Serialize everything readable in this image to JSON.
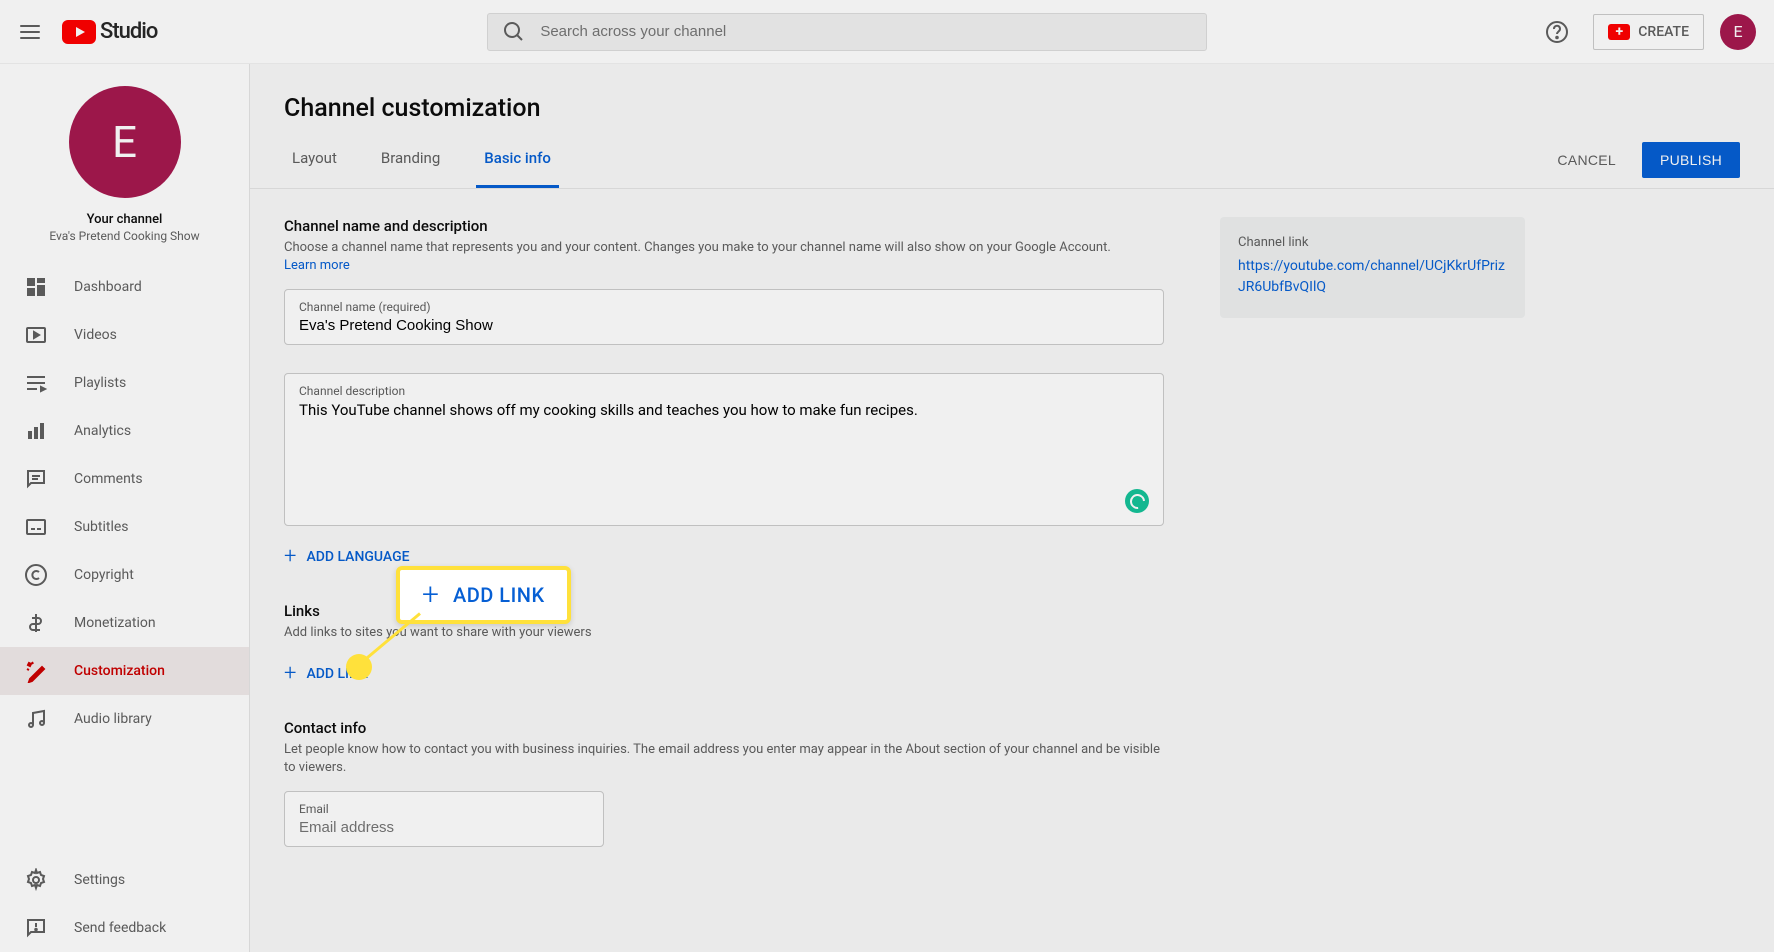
{
  "header": {
    "logo_text": "Studio",
    "search_placeholder": "Search across your channel",
    "create_label": "CREATE",
    "avatar_initial": "E"
  },
  "sidebar": {
    "channel_avatar_initial": "E",
    "your_channel_label": "Your channel",
    "channel_name": "Eva's Pretend Cooking Show",
    "items": [
      {
        "label": "Dashboard"
      },
      {
        "label": "Videos"
      },
      {
        "label": "Playlists"
      },
      {
        "label": "Analytics"
      },
      {
        "label": "Comments"
      },
      {
        "label": "Subtitles"
      },
      {
        "label": "Copyright"
      },
      {
        "label": "Monetization"
      },
      {
        "label": "Customization"
      },
      {
        "label": "Audio library"
      }
    ],
    "footer": [
      {
        "label": "Settings"
      },
      {
        "label": "Send feedback"
      }
    ]
  },
  "page": {
    "title": "Channel customization",
    "tabs": [
      {
        "label": "Layout"
      },
      {
        "label": "Branding"
      },
      {
        "label": "Basic info"
      }
    ],
    "cancel_label": "CANCEL",
    "publish_label": "PUBLISH"
  },
  "basic_info": {
    "name_section_title": "Channel name and description",
    "name_section_desc": "Choose a channel name that represents you and your content. Changes you make to your channel name will also show on your Google Account.",
    "learn_more": "Learn more",
    "channel_name_label": "Channel name (required)",
    "channel_name_value": "Eva's Pretend Cooking Show",
    "channel_desc_label": "Channel description",
    "channel_desc_value": "This YouTube channel shows off my cooking skills and teaches you how to make fun recipes.",
    "add_language_label": "ADD LANGUAGE",
    "links_title": "Links",
    "links_desc": "Add links to sites you want to share with your viewers",
    "add_link_label": "ADD LINK",
    "contact_title": "Contact info",
    "contact_desc": "Let people know how to contact you with business inquiries. The email address you enter may appear in the About section of your channel and be visible to viewers.",
    "email_label": "Email",
    "email_placeholder": "Email address"
  },
  "channel_link": {
    "title": "Channel link",
    "url": "https://youtube.com/channel/UCjKkrUfPrizJR6UbfBvQIlQ"
  },
  "callout": {
    "label": "ADD LINK"
  }
}
